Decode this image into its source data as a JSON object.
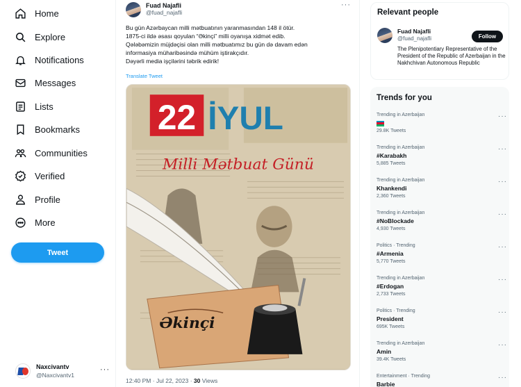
{
  "nav": {
    "items": [
      {
        "label": "Home",
        "icon": "home-icon"
      },
      {
        "label": "Explore",
        "icon": "search-icon"
      },
      {
        "label": "Notifications",
        "icon": "bell-icon"
      },
      {
        "label": "Messages",
        "icon": "envelope-icon"
      },
      {
        "label": "Lists",
        "icon": "list-icon"
      },
      {
        "label": "Bookmarks",
        "icon": "bookmark-icon"
      },
      {
        "label": "Communities",
        "icon": "people-icon"
      },
      {
        "label": "Verified",
        "icon": "verified-icon"
      },
      {
        "label": "Profile",
        "icon": "person-icon"
      },
      {
        "label": "More",
        "icon": "more-circle-icon"
      }
    ],
    "tweet_button": "Tweet"
  },
  "account": {
    "name": "Naxcivantv",
    "handle": "@Naxcivantv1",
    "more": "···"
  },
  "post": {
    "author_name": "Fuad Najafli",
    "author_handle": "@fuad_najafli",
    "more": "···",
    "text_lines": [
      "Bu gün Azərbaycan milli mətbuatının yaranmasından 148 il ötür.",
      "1875-ci ildə əsası qoyulan “Əkinçi” milli oyanışa xidmət edib.",
      "Qələbəmizin müjdəçisi olan milli mətbuatımız bu gün də davam edən",
      "informasiya müharibəsində mühüm iştirakçıdır.",
      "Dəyərli media işçilərini təbrik edirik!"
    ],
    "translate": "Translate Tweet",
    "image": {
      "headline_number": "22",
      "headline_word": "İYUL",
      "subtitle": "Milli Mətbuat Günü",
      "newspaper_title": "Əkinçi"
    },
    "meta": {
      "time": "12:40 PM",
      "separator": "·",
      "date": "Jul 22, 2023",
      "views_count": "30",
      "views_label": "Views"
    }
  },
  "relevant_people": {
    "title": "Relevant people",
    "name": "Fuad Najafli",
    "handle": "@fuad_najafli",
    "follow": "Follow",
    "bio": "The Plenipotentiary Representative of the President of the Republic of Azerbaijan in the Nakhchivan Autonomous Republic"
  },
  "trends": {
    "title": "Trends for you",
    "items": [
      {
        "context": "Trending in Azerbaijan",
        "name": "",
        "flag": true,
        "count": "29.8K Tweets"
      },
      {
        "context": "Trending in Azerbaijan",
        "name": "#Karabakh",
        "count": "5,885 Tweets"
      },
      {
        "context": "Trending in Azerbaijan",
        "name": "Khankendi",
        "count": "2,360 Tweets"
      },
      {
        "context": "Trending in Azerbaijan",
        "name": "#NoBlockade",
        "count": "4,930 Tweets"
      },
      {
        "context": "Politics · Trending",
        "name": "#Armenia",
        "count": "5,770 Tweets"
      },
      {
        "context": "Trending in Azerbaijan",
        "name": "#Erdogan",
        "count": "2,733 Tweets"
      },
      {
        "context": "Politics · Trending",
        "name": "President",
        "count": "695K Tweets"
      },
      {
        "context": "Trending in Azerbaijan",
        "name": "Amin",
        "count": "39.4K Tweets"
      },
      {
        "context": "Entertainment · Trending",
        "name": "Barbie",
        "count": ""
      }
    ],
    "more": "···"
  },
  "colors": {
    "accent": "#1d9bf0",
    "text": "#0f1419",
    "muted": "#536471",
    "banner_red": "#d3202a",
    "banner_blue": "#1f7fae",
    "flag": [
      "#0092bc",
      "#e4002b",
      "#00af66"
    ]
  }
}
